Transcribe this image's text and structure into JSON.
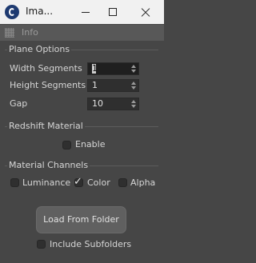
{
  "window": {
    "title": "Ima...",
    "buttons": [
      "minimize",
      "maximize",
      "close"
    ]
  },
  "header": {
    "label": "Info",
    "icon": "grip-icon"
  },
  "plane_options": {
    "title": "Plane Options",
    "width_segments": {
      "label": "Width Segments",
      "value": "1"
    },
    "height_segments": {
      "label": "Height Segments",
      "value": "1"
    },
    "gap": {
      "label": "Gap",
      "value": "10"
    }
  },
  "redshift_material": {
    "title": "Redshift Material",
    "enable": {
      "label": "Enable",
      "checked": false
    }
  },
  "material_channels": {
    "title": "Material Channels",
    "luminance": {
      "label": "Luminance",
      "checked": false
    },
    "color": {
      "label": "Color",
      "checked": true
    },
    "alpha": {
      "label": "Alpha",
      "checked": false
    }
  },
  "actions": {
    "load_label": "Load From Folder",
    "include_subfolders": {
      "label": "Include Subfolders",
      "checked": false
    }
  },
  "colors": {
    "background": "#464646",
    "titlebar": "#f1f1f1",
    "field": "#2f2f2f",
    "button": "#606060"
  }
}
